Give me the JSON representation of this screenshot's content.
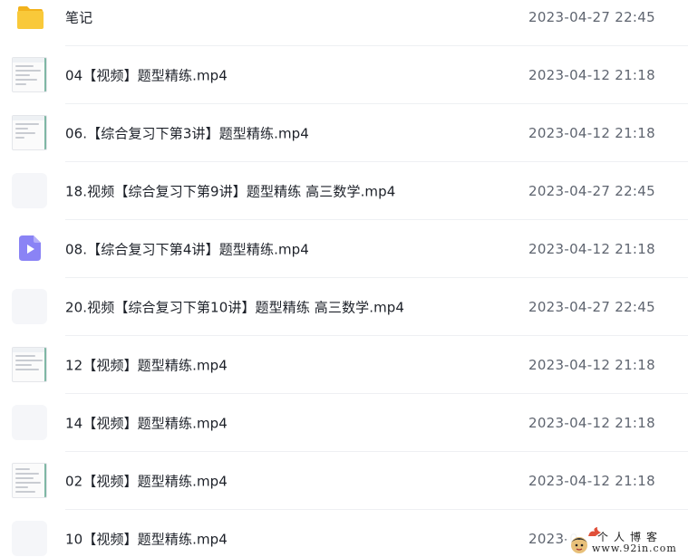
{
  "files": [
    {
      "name": "笔记",
      "date": "2023-04-27 22:45",
      "icon": "folder-icon"
    },
    {
      "name": "04【视频】题型精练.mp4",
      "date": "2023-04-12 21:18",
      "icon": "document-thumbnail"
    },
    {
      "name": "06.【综合复习下第3讲】题型精练.mp4",
      "date": "2023-04-12 21:18",
      "icon": "document-thumbnail"
    },
    {
      "name": "18.视频【综合复习下第9讲】题型精练 高三数学.mp4",
      "date": "2023-04-27 22:45",
      "icon": "blank-thumbnail"
    },
    {
      "name": "08.【综合复习下第4讲】题型精练.mp4",
      "date": "2023-04-12 21:18",
      "icon": "video-file-icon"
    },
    {
      "name": "20.视频【综合复习下第10讲】题型精练 高三数学.mp4",
      "date": "2023-04-27 22:45",
      "icon": "blank-thumbnail"
    },
    {
      "name": "12【视频】题型精练.mp4",
      "date": "2023-04-12 21:18",
      "icon": "document-thumbnail"
    },
    {
      "name": "14【视频】题型精练.mp4",
      "date": "2023-04-12 21:18",
      "icon": "blank-thumbnail"
    },
    {
      "name": "02【视频】题型精练.mp4",
      "date": "2023-04-12 21:18",
      "icon": "document-thumbnail"
    },
    {
      "name": "10【视频】题型精练.mp4",
      "date": "2023-0",
      "icon": "blank-thumbnail"
    }
  ],
  "watermark": {
    "title": "个人博客",
    "url": "www.92in.com"
  },
  "colors": {
    "folder": "#f7c433",
    "video_icon": "#8a83f5",
    "name_text": "#1d2129",
    "date_text": "#5f6570",
    "divider": "#eef0f3"
  }
}
